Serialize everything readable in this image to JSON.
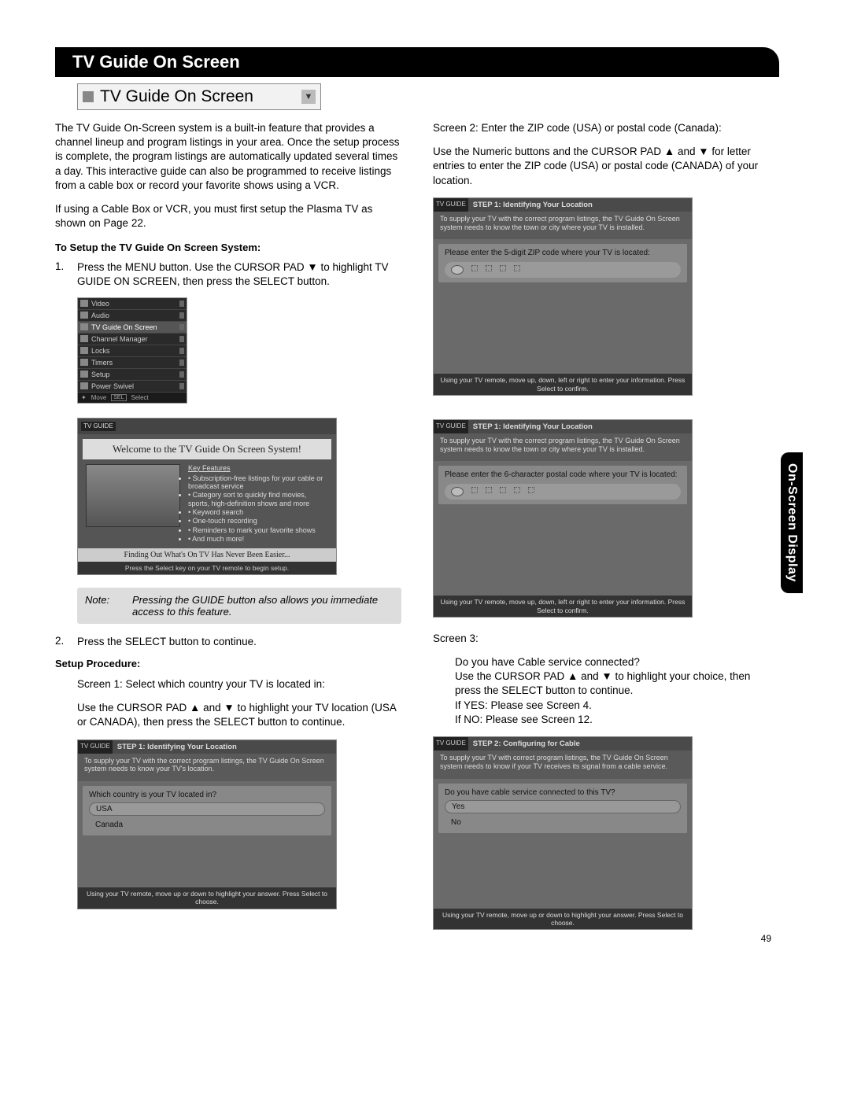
{
  "section_title": "TV Guide On Screen",
  "title_box": "TV Guide On Screen",
  "side_tab": "On-Screen Display",
  "page_number": "49",
  "left": {
    "intro": "The TV Guide On-Screen system is a built-in feature that provides a channel lineup and program listings in your area.  Once the setup process is complete, the program listings are automatically updated several times a day.  This interactive guide can also be programmed to receive listings from a cable box or record your favorite shows using a VCR.",
    "intro2": "If using a Cable Box or VCR, you must first setup the Plasma TV as shown on Page 22.",
    "setup_heading": "To Setup the TV Guide On Screen System:",
    "step1_num": "1.",
    "step1": "Press the MENU button.  Use the CURSOR PAD ▼ to highlight TV GUIDE ON SCREEN, then press the SELECT button.",
    "menu_items": [
      "Video",
      "Audio",
      "TV Guide On Screen",
      "Channel Manager",
      "Locks",
      "Timers",
      "Setup",
      "Power Swivel"
    ],
    "menu_foot_move": "Move",
    "menu_foot_sel": "SEL",
    "menu_foot_select": "Select",
    "welcome": {
      "logo": "TV\nGUIDE",
      "bar": "Welcome to the TV Guide On Screen System!",
      "key_heading": "Key Features",
      "features": [
        "Subscription-free listings for your cable or broadcast service",
        "Category sort to quickly find movies, sports, high-definition shows and more",
        "Keyword search",
        "One-touch recording",
        "Reminders to mark your favorite shows",
        "And much more!"
      ],
      "foot1": "Finding Out What's On TV Has Never Been Easier...",
      "foot2": "Press the Select key on your TV remote to begin setup."
    },
    "note_label": "Note:",
    "note_text": "Pressing the GUIDE button also allows you immediate access to this feature.",
    "step2_num": "2.",
    "step2": "Press the SELECT button to continue.",
    "proc_heading": "Setup Procedure:",
    "screen1_intro": "Screen 1:  Select which country your TV is located in:",
    "screen1_body": "Use the CURSOR PAD ▲ and ▼ to highlight your TV location (USA or CANADA), then press the SELECT button to continue.",
    "wiz1": {
      "logo": "TV\nGUIDE",
      "title": "STEP 1: Identifying Your Location",
      "desc": "To supply your TV with the correct program listings, the TV Guide On Screen system needs to know your TV's location.",
      "question": "Which country is your TV located in?",
      "opt1": "USA",
      "opt2": "Canada",
      "foot": "Using your TV remote, move up or down to highlight your answer.  Press Select to choose."
    }
  },
  "right": {
    "screen2_intro": "Screen 2:  Enter the ZIP code (USA) or postal code (Canada):",
    "screen2_body": "Use the Numeric buttons and the CURSOR PAD ▲ and ▼ for letter entries to enter the ZIP code (USA) or postal code (CANADA) of your location.",
    "wiz2": {
      "logo": "TV\nGUIDE",
      "title": "STEP 1: Identifying Your Location",
      "desc": "To supply your TV with the correct program listings, the TV Guide On Screen system needs to know the town or city where your TV is installed.",
      "question": "Please enter the 5-digit ZIP code where your TV is located:",
      "foot": "Using your TV remote, move up, down, left or right to enter your information.  Press Select to confirm."
    },
    "wiz3": {
      "logo": "TV\nGUIDE",
      "title": "STEP 1: Identifying Your Location",
      "desc": "To supply your TV with the correct program listings, the TV Guide On Screen system needs to know the town or city where your TV is installed.",
      "question": "Please enter the 6-character postal code where your TV is located:",
      "foot": "Using your TV remote, move up, down, left or right to enter your information.  Press Select to confirm."
    },
    "screen3_label": "Screen 3:",
    "screen3_q": "Do you have Cable service connected?",
    "screen3_body": "Use the CURSOR PAD ▲ and ▼ to highlight your choice, then press the SELECT button to continue.",
    "screen3_yes": "If YES:  Please see Screen 4.",
    "screen3_no": "If NO:  Please see Screen 12.",
    "wiz4": {
      "logo": "TV\nGUIDE",
      "title": "STEP 2: Configuring for Cable",
      "desc": "To supply your TV with correct program listings, the TV Guide On Screen system needs to know if your TV receives its signal from a cable service.",
      "question": "Do you have cable service connected to this TV?",
      "opt1": "Yes",
      "opt2": "No",
      "foot": "Using your TV remote, move up or down to highlight your answer.  Press Select to choose."
    }
  }
}
